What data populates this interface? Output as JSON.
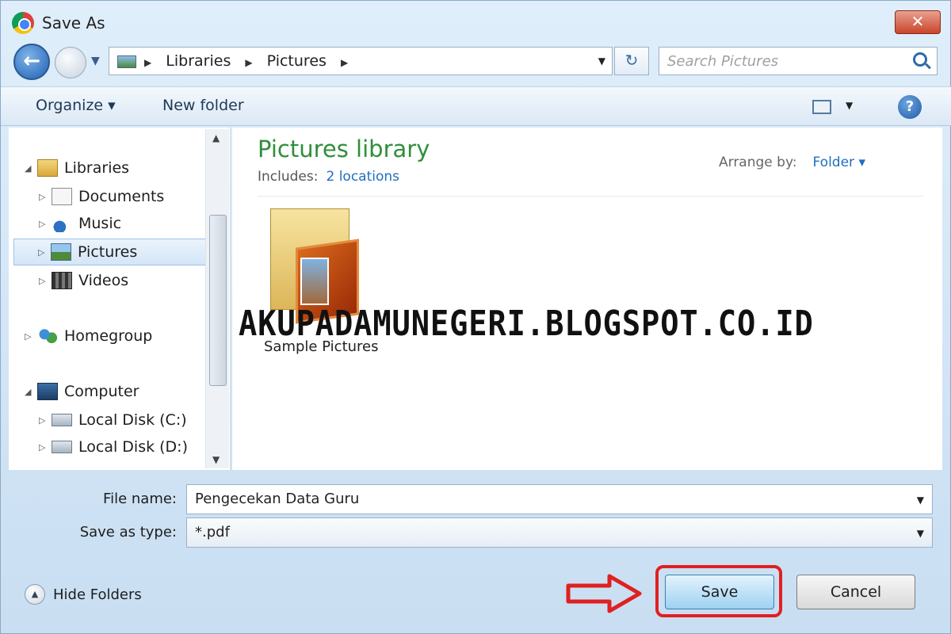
{
  "window": {
    "title": "Save As"
  },
  "address": {
    "crumbs": [
      "Libraries",
      "Pictures"
    ],
    "search_placeholder": "Search Pictures"
  },
  "toolbar": {
    "organize": "Organize ▾",
    "new_folder": "New folder"
  },
  "nav": {
    "items": [
      {
        "label": "Libraries",
        "icon": "library-icon",
        "tri": "◢"
      },
      {
        "label": "Documents",
        "icon": "documents-icon",
        "tri": "▷"
      },
      {
        "label": "Music",
        "icon": "music-icon",
        "tri": "▷"
      },
      {
        "label": "Pictures",
        "icon": "pictures-icon",
        "tri": "▷",
        "selected": true
      },
      {
        "label": "Videos",
        "icon": "videos-icon",
        "tri": "▷"
      },
      {
        "label": "Homegroup",
        "icon": "homegroup-icon",
        "tri": "▷"
      },
      {
        "label": "Computer",
        "icon": "computer-icon",
        "tri": "◢"
      },
      {
        "label": "Local Disk (C:)",
        "icon": "disk-c-icon",
        "tri": "▷"
      },
      {
        "label": "Local Disk (D:)",
        "icon": "disk-d-icon",
        "tri": "▷"
      }
    ]
  },
  "content": {
    "title": "Pictures library",
    "includes_label": "Includes:",
    "includes_link": "2 locations",
    "arrange_label": "Arrange by:",
    "arrange_value": "Folder ▾",
    "folder_label": "Sample Pictures"
  },
  "watermark": "AKUPADAMUNEGERI.BLOGSPOT.CO.ID",
  "form": {
    "file_name_label": "File name:",
    "file_name_value": "Pengecekan Data Guru",
    "save_type_label": "Save as type:",
    "save_type_value": "*.pdf"
  },
  "footer": {
    "hide_folders": "Hide Folders",
    "save": "Save",
    "cancel": "Cancel"
  },
  "colors": {
    "highlight": "#e02020",
    "library_title": "#2f8f3a",
    "link": "#1f6fc0"
  }
}
